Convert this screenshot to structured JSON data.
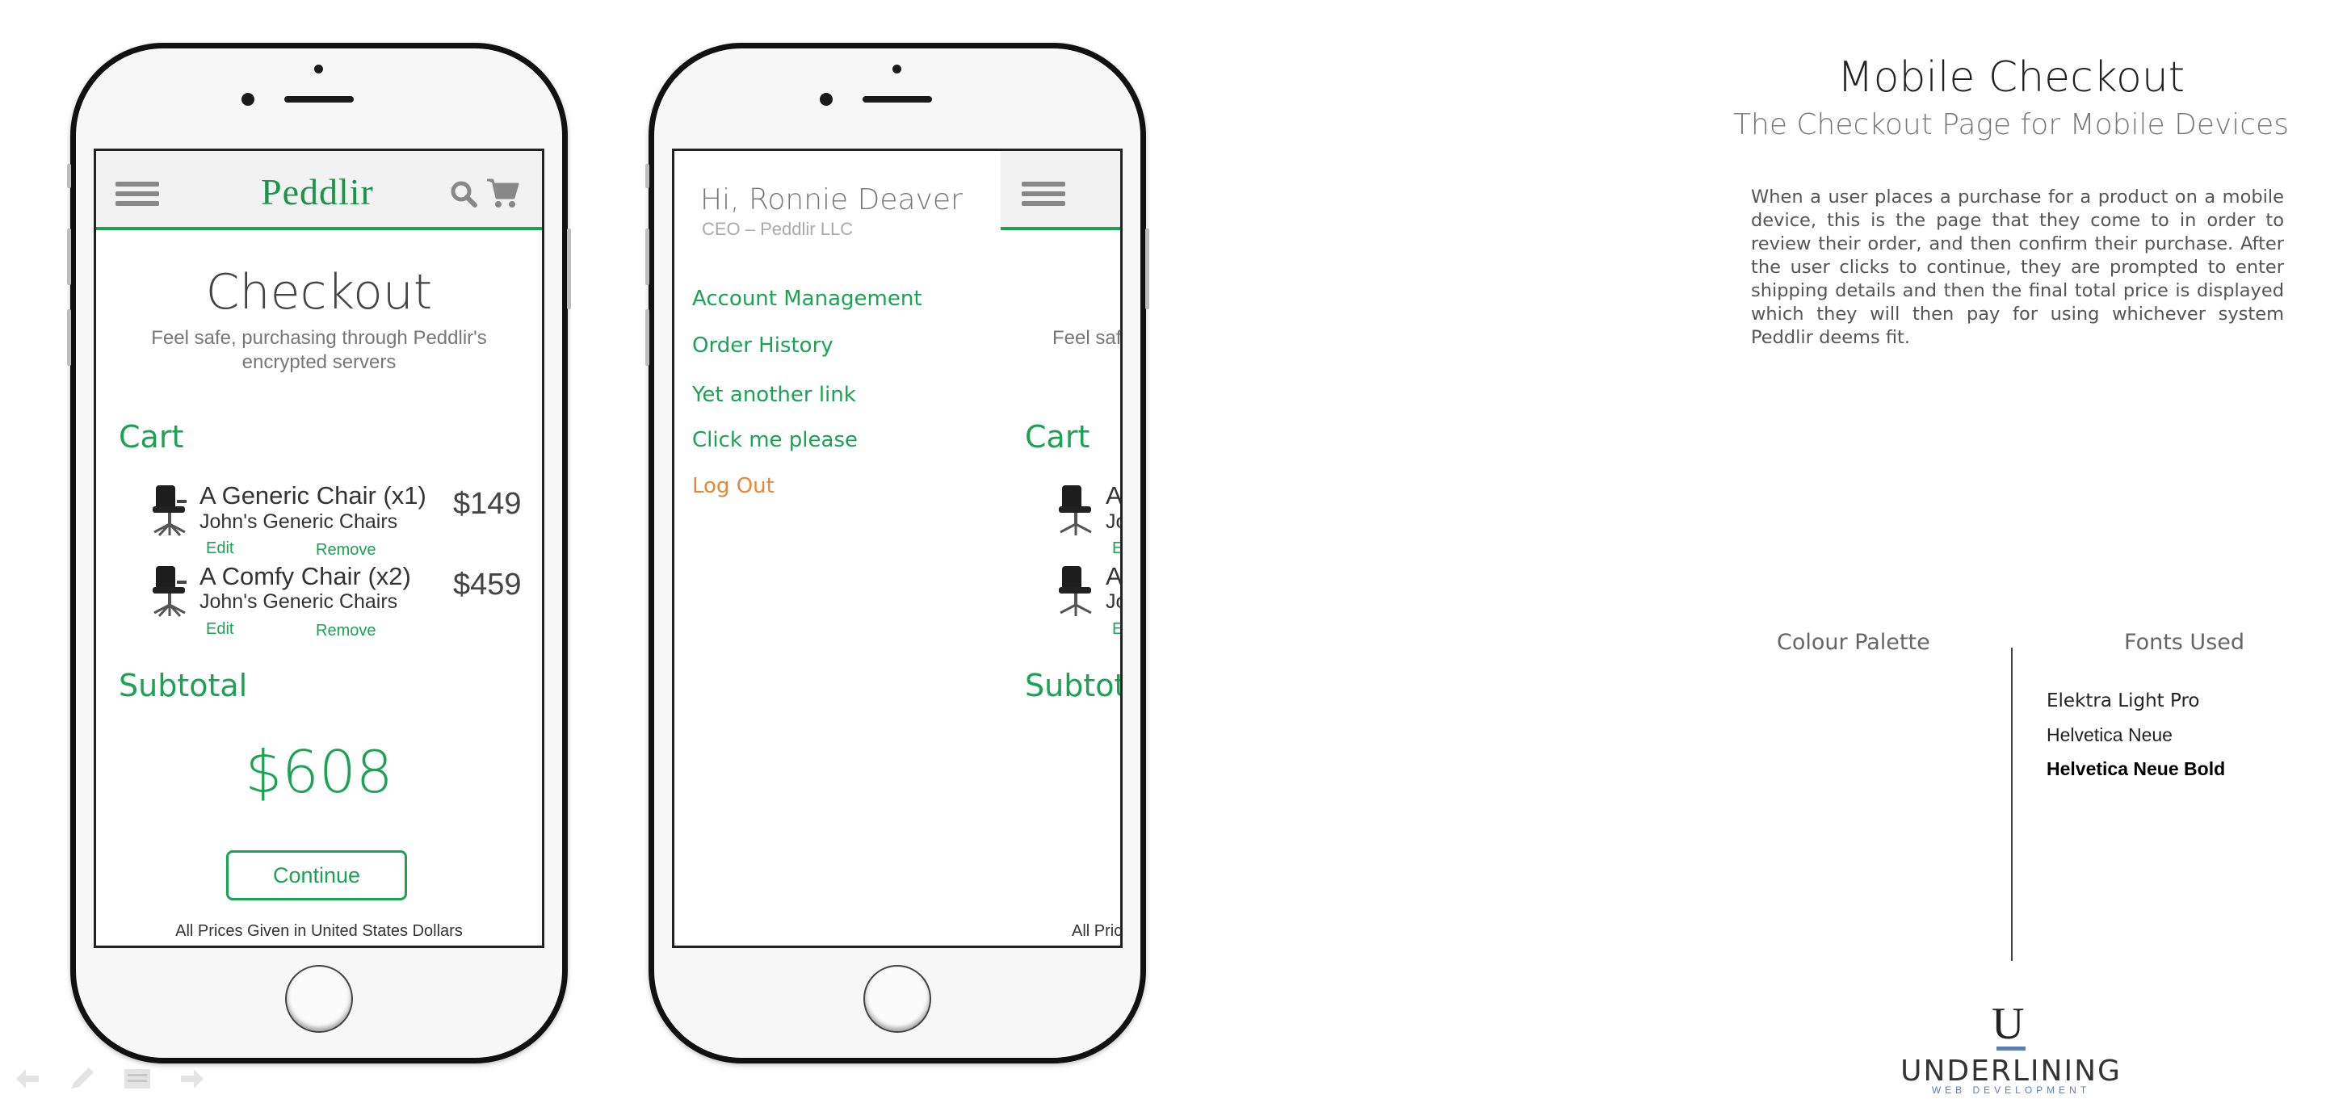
{
  "app": {
    "brand": "Peddlir",
    "checkout_title": "Checkout",
    "checkout_subtitle_1": "Feel safe, purchasing through Peddlir's",
    "checkout_subtitle_2": "encrypted servers",
    "cart_label": "Cart",
    "items": [
      {
        "name": "A Generic Chair (x1)",
        "seller": "John's Generic Chairs",
        "price": "$149",
        "edit": "Edit",
        "remove": "Remove"
      },
      {
        "name": "A Comfy Chair (x2)",
        "seller": "John's Generic Chairs",
        "price": "$459",
        "edit": "Edit",
        "remove": "Remove"
      }
    ],
    "subtotal_label": "Subtotal",
    "subtotal_value": "$608",
    "continue_label": "Continue",
    "footer_note": "All Prices Given in United States Dollars"
  },
  "drawer": {
    "greeting": "Hi, Ronnie Deaver",
    "role": "CEO – Peddlir LLC",
    "links": [
      "Account Management",
      "Order History",
      "Yet another link",
      "Click me please"
    ],
    "logout": "Log Out"
  },
  "peek": {
    "subtitle_fragment": "Feel safe",
    "cart_label": "Cart",
    "item1_name_fragment": "A",
    "item1_seller_fragment": "Jo",
    "item1_edit_fragment": "E",
    "item2_name_fragment": "A",
    "item2_seller_fragment": "Jo",
    "item2_edit_fragment": "E",
    "subtotal_fragment": "Subtota",
    "footer_fragment": "All Pric"
  },
  "panel": {
    "title": "Mobile Checkout",
    "subtitle": "The Checkout Page for Mobile Devices",
    "description": "When a user places a purchase for a product on a mobile device, this is the page that they come to in order to review their order, and then confirm their purchase.  After the user clicks to continue, they are prompted to enter shipping details and then the final total price is displayed which they will then pay for using whichever system Peddlir deems fit.",
    "colour_palette_label": "Colour Palette",
    "fonts_used_label": "Fonts Used",
    "fonts": [
      "Elektra Light Pro",
      "Helvetica Neue",
      "Helvetica Neue Bold"
    ]
  },
  "logo": {
    "mark": "U",
    "name": "UNDERLINING",
    "tagline": "WEB DEVELOPMENT"
  },
  "colors": {
    "brand_green": "#1aa352",
    "logout_orange": "#e8873a",
    "logo_blue": "#5b7fb0"
  },
  "icons": [
    "back-arrow-icon",
    "pen-icon",
    "notes-icon",
    "forward-arrow-icon",
    "search-icon",
    "cart-icon",
    "hamburger-icon",
    "chair-icon"
  ]
}
